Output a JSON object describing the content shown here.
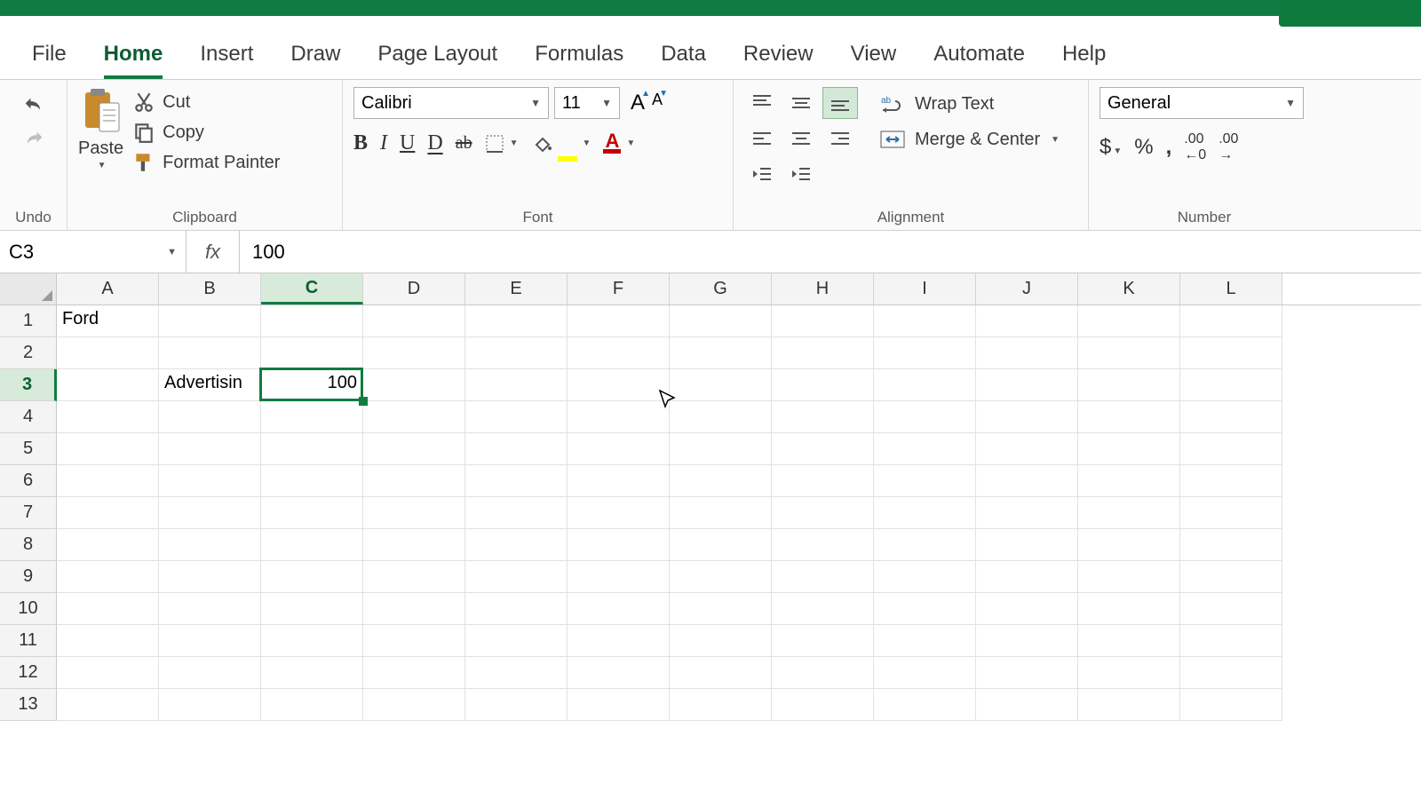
{
  "tabs": {
    "file": "File",
    "home": "Home",
    "insert": "Insert",
    "draw": "Draw",
    "page_layout": "Page Layout",
    "formulas": "Formulas",
    "data": "Data",
    "review": "Review",
    "view": "View",
    "automate": "Automate",
    "help": "Help",
    "active": "home"
  },
  "ribbon": {
    "undo_label": "Undo",
    "clipboard_label": "Clipboard",
    "paste": "Paste",
    "cut": "Cut",
    "copy": "Copy",
    "format_painter": "Format Painter",
    "font_label": "Font",
    "font_name": "Calibri",
    "font_size": "11",
    "alignment_label": "Alignment",
    "wrap_text": "Wrap Text",
    "merge_center": "Merge & Center",
    "number_label": "Number",
    "number_format": "General"
  },
  "formula_bar": {
    "name_box": "C3",
    "fx": "fx",
    "value": "100"
  },
  "columns": [
    "A",
    "B",
    "C",
    "D",
    "E",
    "F",
    "G",
    "H",
    "I",
    "J",
    "K",
    "L"
  ],
  "selected_col": "C",
  "rows": [
    1,
    2,
    3,
    4,
    5,
    6,
    7,
    8,
    9,
    10,
    11,
    12,
    13
  ],
  "selected_row": 3,
  "cells": {
    "A1": "Ford",
    "B3": "Advertisin",
    "C3": "100"
  },
  "active_cell": "C3"
}
